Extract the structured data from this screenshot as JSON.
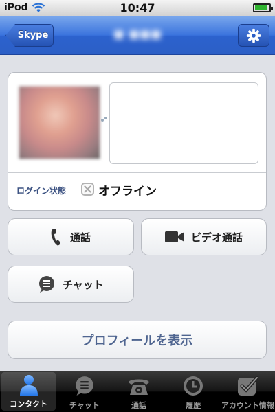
{
  "status_bar": {
    "carrier": "iPod",
    "time": "10:47",
    "battery_level": 0.92
  },
  "nav": {
    "back_label": "Skype",
    "title": "■ ■■■",
    "settings_icon": "gear-icon"
  },
  "contact": {
    "login_status_label": "ログイン状態",
    "status_text": "オフライン",
    "status_icon": "offline-icon"
  },
  "actions": {
    "call_label": "通話",
    "video_call_label": "ビデオ通話",
    "chat_label": "チャット",
    "view_profile_label": "プロフィールを表示"
  },
  "tab_bar": {
    "tabs": [
      {
        "label": "コンタクト",
        "icon": "contacts-icon",
        "active": true
      },
      {
        "label": "チャット",
        "icon": "chat-bubble-icon",
        "active": false
      },
      {
        "label": "通話",
        "icon": "phone-icon",
        "active": false
      },
      {
        "label": "履歴",
        "icon": "clock-icon",
        "active": false
      },
      {
        "label": "アカウント情報",
        "icon": "account-check-icon",
        "active": false
      }
    ]
  },
  "colors": {
    "nav_blue": "#2c62ce",
    "link_blue": "#4f6590",
    "status_label": "#3c5282"
  }
}
